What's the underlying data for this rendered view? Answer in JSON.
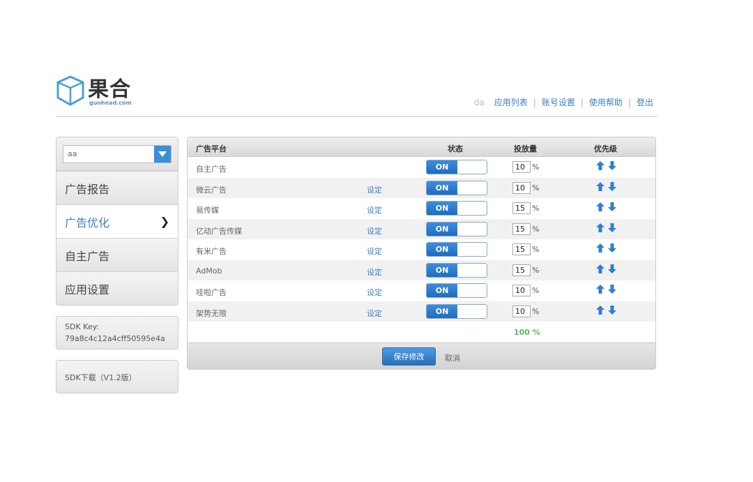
{
  "brand": {
    "name": "果合",
    "domain": "guohead.com"
  },
  "topnav": {
    "user": "da",
    "links": [
      "应用列表",
      "账号设置",
      "使用帮助",
      "登出"
    ]
  },
  "sidebar": {
    "app_select_value": "aa",
    "items": [
      {
        "label": "广告报告"
      },
      {
        "label": "广告优化",
        "active": true
      },
      {
        "label": "自主广告"
      },
      {
        "label": "应用设置"
      }
    ],
    "sdk_key_label": "SDK Key:",
    "sdk_key_value": "79a8c4c12a4cff50595e4a",
    "sdk_download": "SDK下载（V1.2版）"
  },
  "table": {
    "headers": {
      "platform": "广告平台",
      "status": "状态",
      "amount": "投放量",
      "priority": "优先级"
    },
    "set_label": "设定",
    "toggle_label": "ON",
    "percent_sign": "%",
    "rows": [
      {
        "name": "自主广告",
        "has_set": false,
        "amount": "10"
      },
      {
        "name": "微云广告",
        "has_set": true,
        "amount": "10"
      },
      {
        "name": "易传媒",
        "has_set": true,
        "amount": "15"
      },
      {
        "name": "亿动广告传媒",
        "has_set": true,
        "amount": "15"
      },
      {
        "name": "有米广告",
        "has_set": true,
        "amount": "15"
      },
      {
        "name": "AdMob",
        "has_set": true,
        "amount": "15"
      },
      {
        "name": "哇啦广告",
        "has_set": true,
        "amount": "10"
      },
      {
        "name": "架势无限",
        "has_set": true,
        "amount": "10"
      }
    ],
    "total": "100 %",
    "save_label": "保存修改",
    "cancel_label": "取消"
  },
  "colors": {
    "accent": "#3b7fc4",
    "toggle_on": "#2a78cf",
    "total_green": "#5cb85c"
  },
  "icons": {
    "priority_up": "arrow-up-icon",
    "priority_down": "arrow-down-icon"
  }
}
